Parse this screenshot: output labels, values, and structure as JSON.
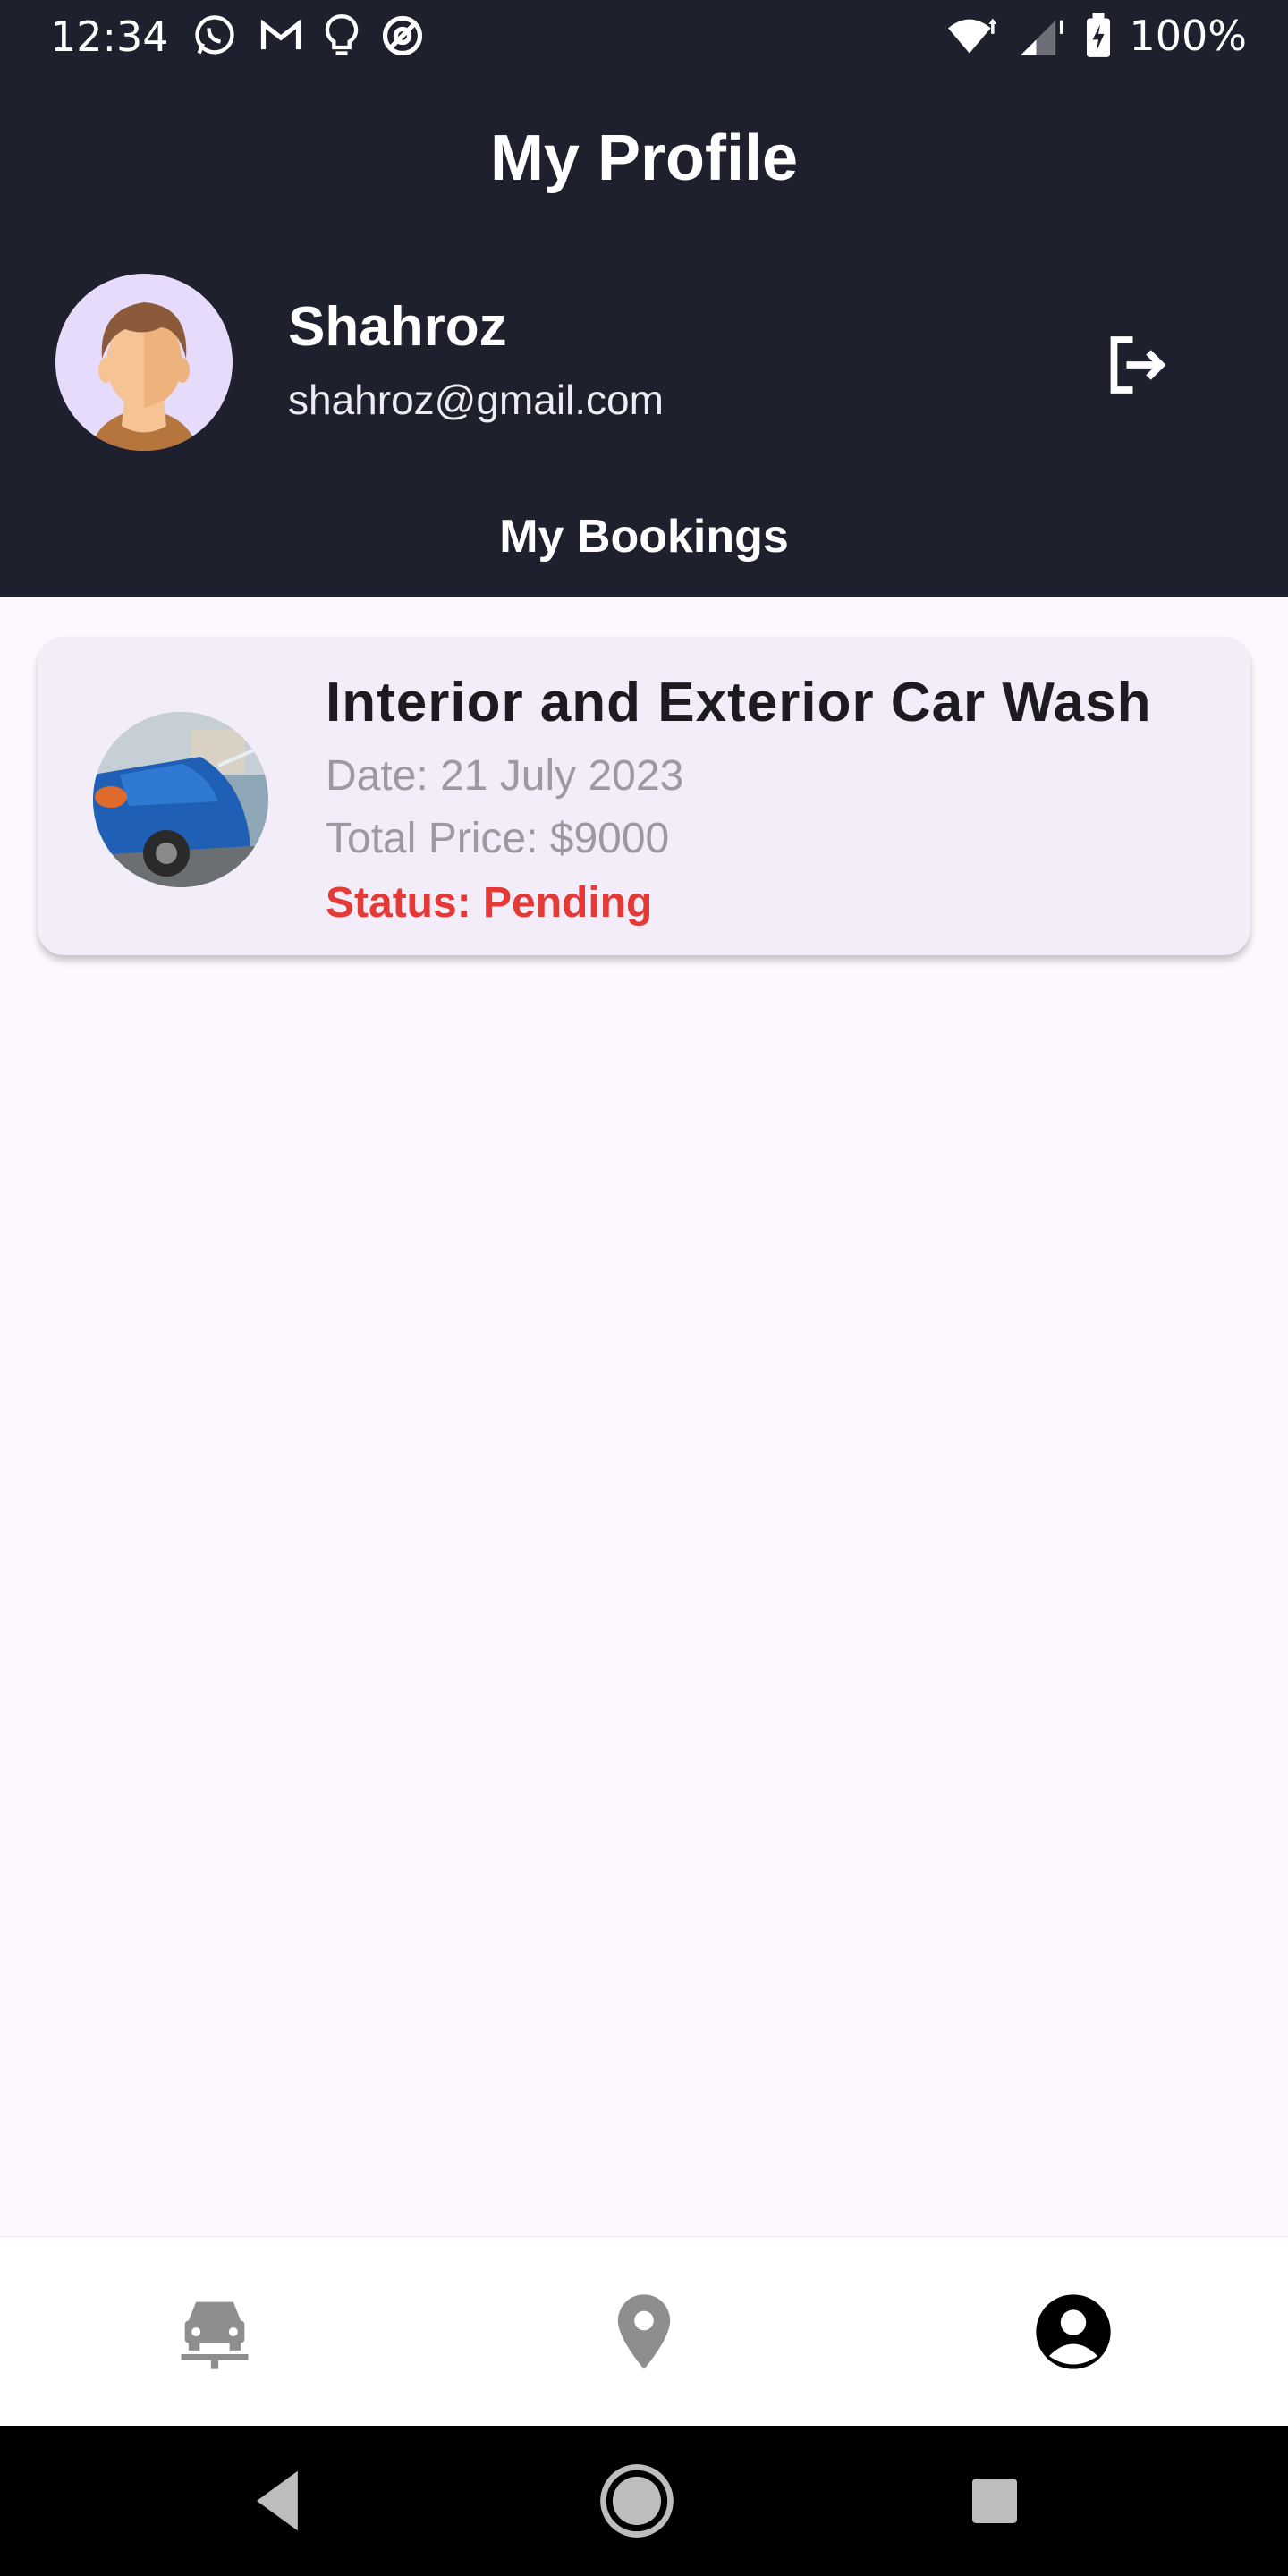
{
  "status_bar": {
    "time": "12:34",
    "battery": "100%",
    "left_icons": [
      "whatsapp-icon",
      "gmail-icon",
      "bulb-icon",
      "at-sign-icon"
    ],
    "right_icons": [
      "wifi-icon",
      "signal-icon",
      "battery-charging-icon"
    ]
  },
  "header": {
    "title": "My Profile"
  },
  "profile": {
    "name": "Shahroz",
    "email": "shahroz@gmail.com"
  },
  "bookings_section": {
    "title": "My Bookings"
  },
  "bookings": [
    {
      "service": "Interior and Exterior Car Wash",
      "date": "Date: 21 July 2023",
      "price": "Total Price: $9000",
      "status": "Status: Pending"
    }
  ],
  "bottom_nav": {
    "items": [
      {
        "icon": "car-wash-icon",
        "active": false
      },
      {
        "icon": "location-pin-icon",
        "active": false
      },
      {
        "icon": "account-circle-icon",
        "active": true
      }
    ]
  },
  "colors": {
    "header_bg": "#1e212d",
    "page_bg": "#fdf8fd",
    "card_bg": "#f2edf8",
    "status_pending": "#e53935",
    "nav_inactive": "#8e8e8e",
    "nav_active": "#000000"
  }
}
